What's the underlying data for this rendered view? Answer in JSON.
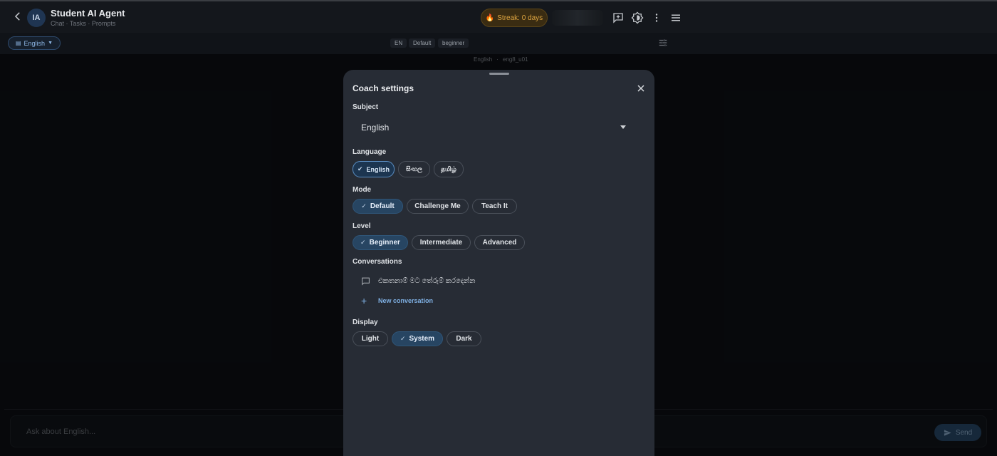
{
  "header": {
    "avatar_initials": "IA",
    "title": "Student AI Agent",
    "subtitle": "Chat · Tasks · Prompts",
    "streak_label": "Streak: 0 days",
    "streak_icon": "flame-icon",
    "icons": [
      "back-arrow-icon",
      "add-chat-icon",
      "brightness-icon",
      "more-vert-icon",
      "menu-icon"
    ]
  },
  "subbar": {
    "language_pill": "English",
    "tags": [
      "EN",
      "Default",
      "beginner"
    ],
    "crumbs": [
      "English",
      "·",
      "eng8_u01"
    ]
  },
  "composer": {
    "placeholder": "Ask about English...",
    "send_label": "Send"
  },
  "sheet": {
    "title": "Coach settings",
    "subject_label": "Subject",
    "subject_value": "English",
    "language_label": "Language",
    "languages": [
      {
        "label": "English",
        "selected": true
      },
      {
        "label": "සිංහල",
        "selected": false
      },
      {
        "label": "தமிழ்",
        "selected": false
      }
    ],
    "mode_label": "Mode",
    "modes": [
      {
        "label": "Default",
        "selected": true
      },
      {
        "label": "Challenge Me",
        "selected": false
      },
      {
        "label": "Teach It",
        "selected": false
      }
    ],
    "level_label": "Level",
    "levels": [
      {
        "label": "Beginner",
        "selected": true
      },
      {
        "label": "Intermediate",
        "selected": false
      },
      {
        "label": "Advanced",
        "selected": false
      }
    ],
    "conversations_label": "Conversations",
    "conversations": [
      "එකතනාම් මට තේරුම් කරදෙන්න"
    ],
    "new_conversation_label": "New conversation",
    "display_label": "Display",
    "displays": [
      {
        "label": "Light",
        "selected": false
      },
      {
        "label": "System",
        "selected": true
      },
      {
        "label": "Dark",
        "selected": false
      }
    ]
  },
  "colors": {
    "accent": "#274562",
    "streak": "#e0a640",
    "link": "#7fb0e3"
  }
}
